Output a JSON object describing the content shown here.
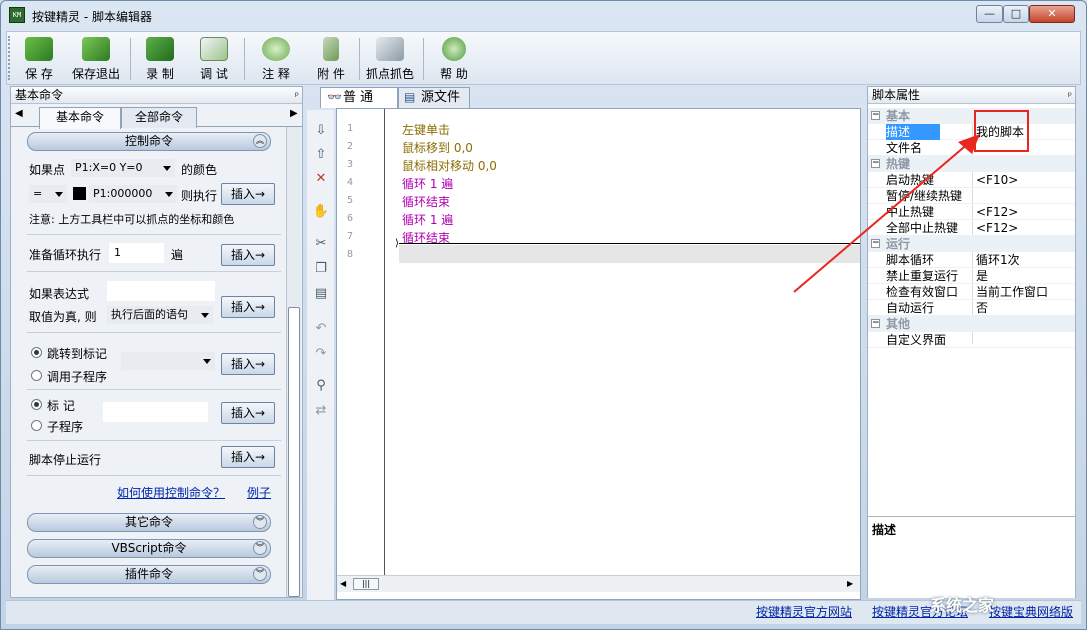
{
  "window": {
    "title": "按键精灵 - 脚本编辑器",
    "icon_text": "KM"
  },
  "window_controls": {
    "minimize": "—",
    "maximize": "□",
    "close": "✕"
  },
  "toolbar": [
    {
      "label": "保 存",
      "icon": "save-icon"
    },
    {
      "label": "保存退出",
      "icon": "save-exit-icon"
    },
    {
      "label": "录 制",
      "icon": "record-camera-icon"
    },
    {
      "label": "调 试",
      "icon": "debug-clipboard-icon"
    },
    {
      "label": "注 释",
      "icon": "comment-bubble-icon"
    },
    {
      "label": "附 件",
      "icon": "attachment-icon"
    },
    {
      "label": "抓点抓色",
      "icon": "color-picker-icon"
    },
    {
      "label": "帮 助",
      "icon": "help-icon"
    }
  ],
  "left_panel": {
    "title": "基本命令",
    "pin": "ᵖ",
    "tabs": [
      "基本命令",
      "全部命令"
    ],
    "group_control": "控制命令",
    "if_point_label": "如果点",
    "point_select": "P1:X=0 Y=0",
    "color_of": "的颜色",
    "operator": "=",
    "color_value": "P1:000000",
    "then_exec": "则执行",
    "insert": "插入→",
    "note": "注意: 上方工具栏中可以抓点的坐标和颜色",
    "loop_label": "准备循环执行",
    "loop_count": "1",
    "loop_unit": "遍",
    "expr_label": "如果表达式",
    "expr_value": "",
    "true_label": "取值为真, 则",
    "true_select": "执行后面的语句",
    "jump_label": "跳转到标记",
    "call_label": "调用子程序",
    "mark_label": "标 记",
    "sub_label": "子程序",
    "stop_label": "脚本停止运行",
    "help_link": "如何使用控制命令？",
    "example_link": "例子",
    "group_other": "其它命令",
    "group_vbs": "VBScript命令",
    "group_plugin": "插件命令"
  },
  "editor": {
    "tabs": [
      "普 通",
      "源文件"
    ],
    "lines": [
      {
        "n": "1",
        "text": "左键单击",
        "color": "#8b6d00"
      },
      {
        "n": "2",
        "text": "鼠标移到 0,0",
        "color": "#8b6d00"
      },
      {
        "n": "3",
        "text": "鼠标相对移动 0,0",
        "color": "#8b6d00"
      },
      {
        "n": "4",
        "text": "循环 1 遍",
        "color": "#b000b0"
      },
      {
        "n": "5",
        "text": "循环结束",
        "color": "#b000b0"
      },
      {
        "n": "6",
        "text": "循环 1 遍",
        "color": "#b000b0"
      },
      {
        "n": "7",
        "text": "循环结束",
        "color": "#b000b0"
      },
      {
        "n": "8",
        "text": "",
        "color": "#000000"
      }
    ],
    "hscroll_grip": "|||"
  },
  "right_panel": {
    "title": "脚本属性",
    "pin": "ᵖ",
    "categories": [
      {
        "name": "基本",
        "rows": [
          {
            "key": "描述",
            "value": "我的脚本"
          },
          {
            "key": "文件名",
            "value": ""
          }
        ]
      },
      {
        "name": "热键",
        "rows": [
          {
            "key": "启动热键",
            "value": "<F10>"
          },
          {
            "key": "暂停/继续热键",
            "value": ""
          },
          {
            "key": "中止热键",
            "value": "<F12>"
          },
          {
            "key": "全部中止热键",
            "value": "<F12>"
          }
        ]
      },
      {
        "name": "运行",
        "rows": [
          {
            "key": "脚本循环",
            "value": "循环1次"
          },
          {
            "key": "禁止重复运行",
            "value": "是"
          },
          {
            "key": "检查有效窗口",
            "value": "当前工作窗口"
          },
          {
            "key": "自动运行",
            "value": "否"
          }
        ]
      },
      {
        "name": "其他",
        "rows": [
          {
            "key": "自定义界面",
            "value": ""
          }
        ]
      }
    ],
    "desc_title": "描述"
  },
  "status": {
    "link1": "按键精灵官方网站",
    "link2": "按键精灵官方论坛",
    "link3": "按键宝典网络版"
  },
  "watermark": "系统之家",
  "colors": {
    "annotation": "#e8271f",
    "link": "#0024a8"
  }
}
